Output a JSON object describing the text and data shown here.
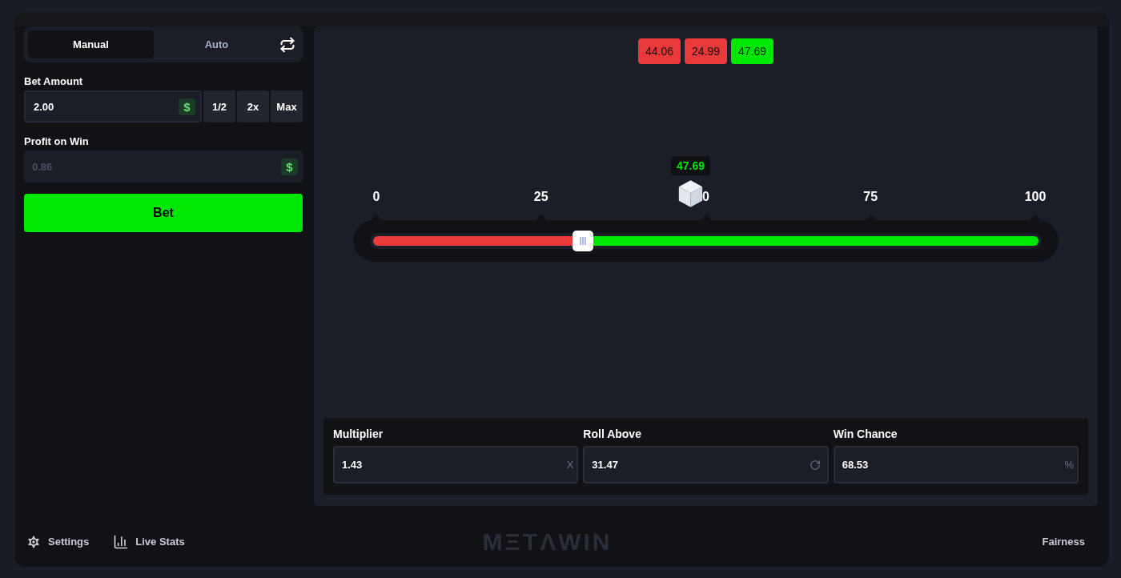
{
  "tabs": [
    {
      "label": "Manual",
      "selected": true
    },
    {
      "label": "Auto",
      "selected": false
    }
  ],
  "bet_amount": {
    "label": "Bet Amount",
    "value": "2.00",
    "currency": "$",
    "buttons": [
      "1/2",
      "2x",
      "Max"
    ]
  },
  "profit_on_win": {
    "label": "Profit on Win",
    "value": "0.86",
    "currency": "$",
    "disabled": true
  },
  "bet_button": "Bet",
  "history": [
    {
      "value": "44.06",
      "color": "#e83a3a"
    },
    {
      "value": "24.99",
      "color": "#e83a3a"
    },
    {
      "value": "47.69",
      "color": "#00e701"
    }
  ],
  "slider": {
    "ticks": [
      "0",
      "25",
      "0",
      "75",
      "100"
    ],
    "level": 0.3147,
    "result": {
      "value": "47.69",
      "level": 0.4769
    }
  },
  "stats": [
    {
      "label": "Multiplier",
      "value": "1.43",
      "kind": "suffix",
      "suffix": "X"
    },
    {
      "label": "Roll Above",
      "value": "31.47",
      "kind": "reset"
    },
    {
      "label": "Win Chance",
      "value": "68.53",
      "kind": "suffix",
      "suffix": "%"
    }
  ],
  "footer": {
    "settings": "Settings",
    "live_stats": "Live Stats",
    "logo": "MΞTΛWIN",
    "fairness": "Fairness"
  }
}
